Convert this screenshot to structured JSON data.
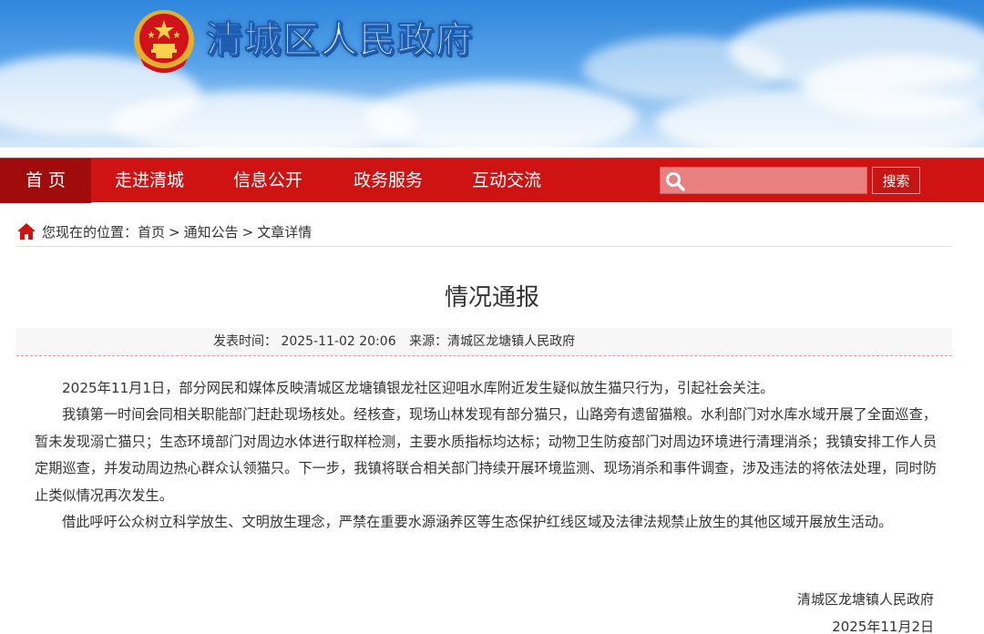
{
  "header": {
    "site_title": "清城区人民政府",
    "emblem_icon": "national-emblem-icon"
  },
  "nav": {
    "items": [
      {
        "label": "首 页",
        "active": true
      },
      {
        "label": "走进清城",
        "active": false
      },
      {
        "label": "信息公开",
        "active": false
      },
      {
        "label": "政务服务",
        "active": false
      },
      {
        "label": "互动交流",
        "active": false
      }
    ],
    "search": {
      "placeholder": "",
      "value": "",
      "button_label": "搜索",
      "icon": "search-icon"
    },
    "colors": {
      "bar": "#cf1313",
      "active": "#a00b0b"
    }
  },
  "breadcrumb": {
    "icon": "home-icon",
    "prefix": "您现在的位置：",
    "items": [
      "首页",
      "通知公告",
      "文章详情"
    ],
    "separator": ">"
  },
  "article": {
    "title": "情况通报",
    "meta": {
      "publish_label": "发表时间：",
      "publish_time": "2025-11-02 20:06",
      "source_label": "来源：",
      "source": "清城区龙塘镇人民政府"
    },
    "paragraphs": [
      "2025年11月1日，部分网民和媒体反映清城区龙塘镇银龙社区迎咀水库附近发生疑似放生猫只行为，引起社会关注。",
      "我镇第一时间会同相关职能部门赶赴现场核处。经核查，现场山林发现有部分猫只，山路旁有遗留猫粮。水利部门对水库水域开展了全面巡查，暂未发现溺亡猫只；生态环境部门对周边水体进行取样检测，主要水质指标均达标；动物卫生防疫部门对周边环境进行清理消杀；我镇安排工作人员定期巡查，并发动周边热心群众认领猫只。下一步，我镇将联合相关部门持续开展环境监测、现场消杀和事件调查，涉及违法的将依法处理，同时防止类似情况再次发生。",
      "借此呼吁公众树立科学放生、文明放生理念，严禁在重要水源涵养区等生态保护红线区域及法律法规禁止放生的其他区域开展放生活动。"
    ],
    "signature": {
      "org": "清城区龙塘镇人民政府",
      "date": "2025年11月2日"
    }
  }
}
